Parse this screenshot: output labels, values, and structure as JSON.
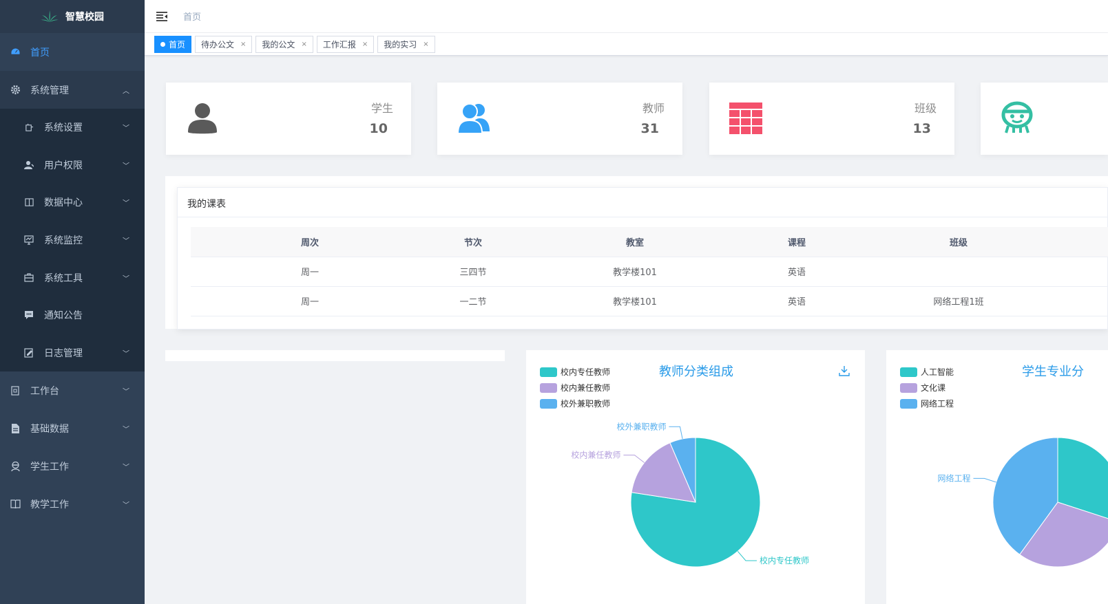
{
  "app": {
    "title": "智慧校园"
  },
  "sidebar": {
    "items": [
      {
        "label": "首页",
        "icon": "dashboard-icon",
        "active": true
      },
      {
        "label": "系统管理",
        "icon": "gear-icon",
        "open": true,
        "children": [
          {
            "label": "系统设置",
            "icon": "settings-icon"
          },
          {
            "label": "用户权限",
            "icon": "user-icon"
          },
          {
            "label": "数据中心",
            "icon": "database-icon"
          },
          {
            "label": "系统监控",
            "icon": "monitor-icon"
          },
          {
            "label": "系统工具",
            "icon": "toolbox-icon"
          },
          {
            "label": "通知公告",
            "icon": "message-icon"
          },
          {
            "label": "日志管理",
            "icon": "log-icon"
          }
        ]
      },
      {
        "label": "工作台",
        "icon": "workbench-icon"
      },
      {
        "label": "基础数据",
        "icon": "file-icon"
      },
      {
        "label": "学生工作",
        "icon": "student-icon"
      },
      {
        "label": "教学工作",
        "icon": "book-icon"
      }
    ]
  },
  "header": {
    "breadcrumb": "首页"
  },
  "tags": [
    {
      "label": "首页",
      "active": true
    },
    {
      "label": "待办公文",
      "close": "×"
    },
    {
      "label": "我的公文",
      "close": "×"
    },
    {
      "label": "工作汇报",
      "close": "×"
    },
    {
      "label": "我的实习",
      "close": "×"
    }
  ],
  "stats": [
    {
      "label": "学生",
      "value": "10",
      "color": "#5a5a5a",
      "icon": "person-icon"
    },
    {
      "label": "教师",
      "value": "31",
      "color": "#36a3f7",
      "icon": "people-icon"
    },
    {
      "label": "班级",
      "value": "13",
      "color": "#f4516c",
      "icon": "grid-icon"
    },
    {
      "label": "",
      "value": "",
      "color": "#34bfa3",
      "icon": "robot-icon"
    }
  ],
  "schedule": {
    "title": "我的课表",
    "columns": [
      "周次",
      "节次",
      "教室",
      "课程",
      "班级"
    ],
    "rows": [
      [
        "周一",
        "三四节",
        "教学楼101",
        "英语",
        ""
      ],
      [
        "周一",
        "一二节",
        "教学楼101",
        "英语",
        "网络工程1班"
      ]
    ]
  },
  "chart_data": [
    {
      "type": "pie",
      "title": "教师分类组成",
      "categories": [
        "校内专任教师",
        "校内兼任教师",
        "校外兼职教师"
      ],
      "values": [
        24,
        5,
        2
      ],
      "colors": [
        "#2ec7c9",
        "#b6a2de",
        "#5ab1ef"
      ],
      "legend": "top-left"
    },
    {
      "type": "pie",
      "title": "学生专业分",
      "categories": [
        "人工智能",
        "文化课",
        "网络工程"
      ],
      "values": [
        3,
        3,
        4
      ],
      "colors": [
        "#2ec7c9",
        "#b6a2de",
        "#5ab1ef"
      ],
      "legend": "top-left"
    }
  ],
  "colors": {
    "sidebar_bg": "#304156",
    "accent": "#409eff",
    "tag_active": "#1890ff"
  }
}
